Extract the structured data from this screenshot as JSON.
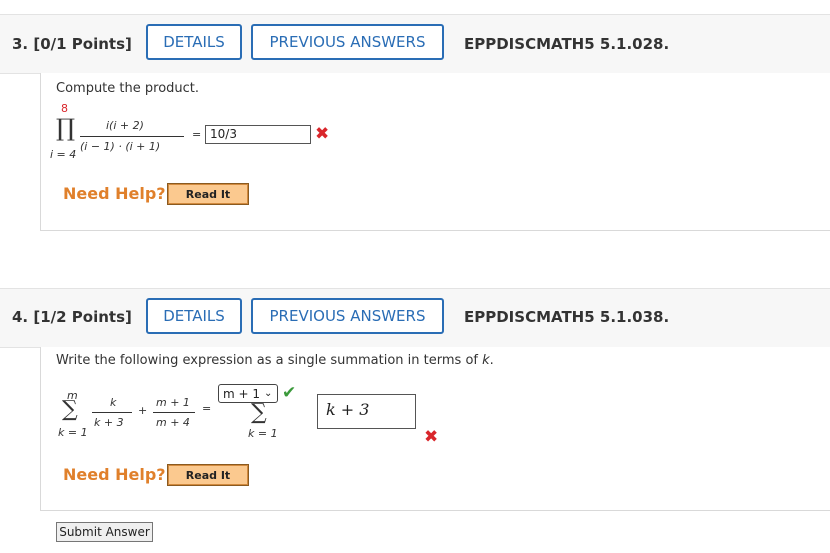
{
  "q3": {
    "number": "3.",
    "points": "[0/1 Points]",
    "details_label": "DETAILS",
    "previous_label": "PREVIOUS ANSWERS",
    "code": "EPPDISCMATH5 5.1.028.",
    "prompt": "Compute the product.",
    "upper": "8",
    "lower": "i = 4",
    "numerator": "i(i + 2)",
    "denominator": "(i − 1) · (i + 1)",
    "equals": "=",
    "answer": "10/3",
    "status": "incorrect",
    "need_help": "Need Help?",
    "read_it": "Read It"
  },
  "q4": {
    "number": "4.",
    "points": "[1/2 Points]",
    "details_label": "DETAILS",
    "previous_label": "PREVIOUS ANSWERS",
    "code": "EPPDISCMATH5 5.1.038.",
    "prompt_pre": "Write the following expression as a single summation in terms of ",
    "prompt_var": "k",
    "prompt_post": ".",
    "sum_upper": "m",
    "sum_lower": "k = 1",
    "term1_num": "k",
    "term1_den": "k + 3",
    "plus": "+",
    "term2_num": "m + 1",
    "term2_den": "m + 4",
    "equals": "=",
    "select_value": "m + 1",
    "rhs_lower": "k = 1",
    "answer": "k + 3",
    "select_status": "correct",
    "answer_status": "incorrect",
    "need_help": "Need Help?",
    "read_it": "Read It",
    "submit": "Submit Answer"
  },
  "icons": {
    "incorrect": "x-mark-icon",
    "correct": "check-mark-icon"
  },
  "colors": {
    "accent": "#2a6db5",
    "incorrect": "#d9262b",
    "correct": "#3b9a3b",
    "help": "#e0802b"
  }
}
